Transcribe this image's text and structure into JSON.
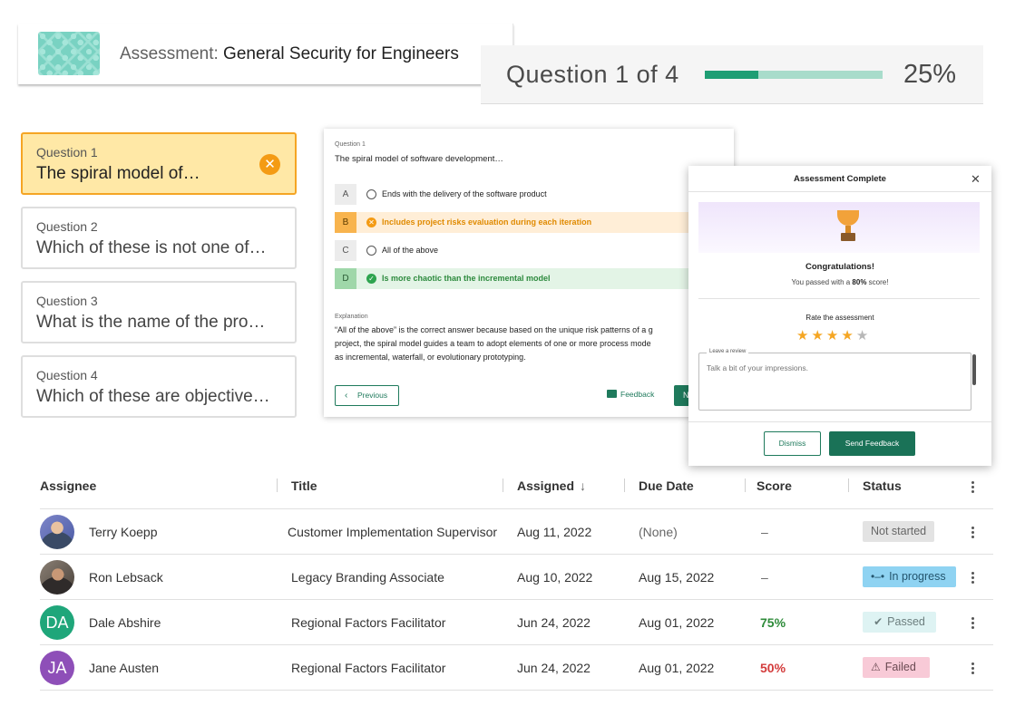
{
  "header": {
    "title_prefix": "Assessment:",
    "title": "General Security for Engineers"
  },
  "progress": {
    "label": "Question 1 of 4",
    "percent_text": "25%",
    "fraction": 0.3
  },
  "questions": [
    {
      "num": "Question 1",
      "text": "The spiral model of…"
    },
    {
      "num": "Question 2",
      "text": "Which of these is not one of…"
    },
    {
      "num": "Question 3",
      "text": "What is the name of the pro…"
    },
    {
      "num": "Question 4",
      "text": "Which of these are objective…"
    }
  ],
  "question_panel": {
    "label": "Question 1",
    "question": "The spiral model of software development…",
    "options": [
      {
        "letter": "A",
        "text": "Ends with the delivery of the software product"
      },
      {
        "letter": "B",
        "text": "Includes project risks evaluation during each iteration"
      },
      {
        "letter": "C",
        "text": "All of the above"
      },
      {
        "letter": "D",
        "text": "Is more chaotic than the incremental model"
      }
    ],
    "explanation_label": "Explanation",
    "explanation_lines": [
      "“All of the above” is the correct answer because based on the unique risk patterns of a g",
      "project, the spiral model guides a team to adopt elements of one or more process mode",
      "as incremental, waterfall, or evolutionary prototyping."
    ],
    "previous_label": "Previous",
    "feedback_label": "Feedback",
    "next_label": "N"
  },
  "modal": {
    "title": "Assessment Complete",
    "congrats": "Congratulations!",
    "passed_prefix": "You passed with a ",
    "passed_score": "80%",
    "passed_suffix": " score!",
    "rate_label": "Rate the assessment",
    "rating": 4,
    "rating_max": 5,
    "review_legend": "Leave a review",
    "review_placeholder": "Talk a bit of your impressions.",
    "dismiss_label": "Dismiss",
    "send_label": "Send Feedback"
  },
  "table": {
    "columns": [
      "Assignee",
      "Title",
      "Assigned",
      "Due Date",
      "Score",
      "Status"
    ],
    "sort_arrow": "↓",
    "rows": [
      {
        "name": "Terry Koepp",
        "avatar": "",
        "title": "Customer Implementation Supervisor",
        "assigned": "Aug 11, 2022",
        "due": "(None)",
        "score": "–",
        "status": "Not started"
      },
      {
        "name": "Ron Lebsack",
        "avatar": "",
        "title": "Legacy Branding Associate",
        "assigned": "Aug 10, 2022",
        "due": "Aug 15, 2022",
        "score": "–",
        "status": "In progress"
      },
      {
        "name": "Dale Abshire",
        "avatar": "DA",
        "title": "Regional Factors Facilitator",
        "assigned": "Jun 24, 2022",
        "due": "Aug 01, 2022",
        "score": "75%",
        "status": "Passed"
      },
      {
        "name": "Jane Austen",
        "avatar": "JA",
        "title": "Regional Factors Facilitator",
        "assigned": "Jun 24, 2022",
        "due": "Aug 01, 2022",
        "score": "50%",
        "status": "Failed"
      }
    ]
  },
  "colors": {
    "brand_green": "#1f7a5c",
    "progress_fill": "#1f9e74",
    "warning_orange": "#f49b14",
    "avatar_da": "#1fa67a",
    "avatar_ja": "#8e4fb8"
  }
}
